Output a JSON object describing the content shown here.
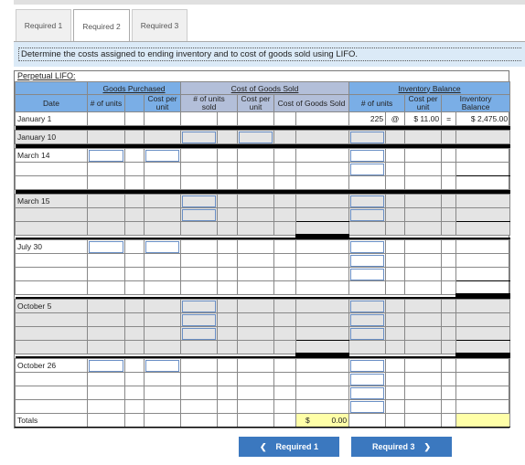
{
  "tabs": [
    {
      "label": "Required 1",
      "active": false
    },
    {
      "label": "Required 2",
      "active": true
    },
    {
      "label": "Required 3",
      "active": false
    }
  ],
  "instruction": "Determine the costs assigned to ending inventory and to cost of goods sold using LIFO.",
  "table_title": "Perpetual LIFO:",
  "headers": {
    "goods_purchased": "Goods Purchased",
    "cost_of_goods_sold": "Cost of Goods Sold",
    "inventory_balance": "Inventory Balance",
    "date": "Date",
    "gp_units": "# of units",
    "gp_cost": "Cost per unit",
    "cogs_units": "# of units sold",
    "cogs_cost": "Cost per unit",
    "cogs_total": "Cost of Goods Sold",
    "inv_units": "# of units",
    "inv_cost": "Cost per unit",
    "inv_balance": "Inventory Balance"
  },
  "jan1": {
    "date": "January 1",
    "units": "225",
    "at": "@",
    "cost": "$ 11.00",
    "eq": "=",
    "balance": "$  2,475.00"
  },
  "groups": [
    {
      "date": "January 10",
      "gray": true,
      "rows": [
        {
          "in": [
            "sold",
            "cpu",
            "inv"
          ]
        }
      ]
    },
    {
      "date": "March 14",
      "gray": false,
      "rows": [
        {
          "in": [
            "gpu",
            "gpc",
            "inv"
          ]
        },
        {
          "in": [
            "inv"
          ],
          "ul": [
            "bal"
          ]
        },
        {
          "in": []
        }
      ]
    },
    {
      "date": "March 15",
      "gray": true,
      "rows": [
        {
          "in": [
            "sold",
            "inv"
          ]
        },
        {
          "in": [
            "sold",
            "inv"
          ],
          "ul": [
            "cogs",
            "bal"
          ]
        },
        {
          "in": [],
          "tb": [
            "cogs"
          ]
        }
      ]
    },
    {
      "date": "July 30",
      "gray": false,
      "rows": [
        {
          "in": [
            "gpu",
            "gpc",
            "inv"
          ]
        },
        {
          "in": [
            "inv"
          ]
        },
        {
          "in": [
            "inv"
          ],
          "ul": [
            "bal"
          ]
        },
        {
          "in": [],
          "tb": [
            "bal"
          ]
        }
      ]
    },
    {
      "date": "October 5",
      "gray": true,
      "rows": [
        {
          "in": [
            "sold",
            "inv"
          ]
        },
        {
          "in": [
            "sold",
            "inv"
          ]
        },
        {
          "in": [
            "sold",
            "inv"
          ],
          "ul": [
            "cogs",
            "bal"
          ]
        },
        {
          "in": [],
          "tb": [
            "cogs",
            "bal"
          ]
        }
      ]
    },
    {
      "date": "October 26",
      "gray": false,
      "rows": [
        {
          "in": [
            "gpu",
            "gpc",
            "inv"
          ]
        },
        {
          "in": [
            "inv"
          ]
        },
        {
          "in": [
            "inv"
          ]
        },
        {
          "in": [
            "inv"
          ]
        }
      ]
    }
  ],
  "totals": {
    "label": "Totals",
    "cogs_currency": "$",
    "cogs_value": "0.00",
    "balance": ""
  },
  "nav": {
    "prev": "Required 1",
    "next": "Required 3",
    "prev_icon": "chevron-left-icon",
    "next_icon": "chevron-right-icon"
  },
  "colors": {
    "header_blue": "#7aaee6",
    "header_cogs": "#b3bfd9",
    "button": "#3b78bf",
    "total_highlight": "#ffffa8"
  }
}
